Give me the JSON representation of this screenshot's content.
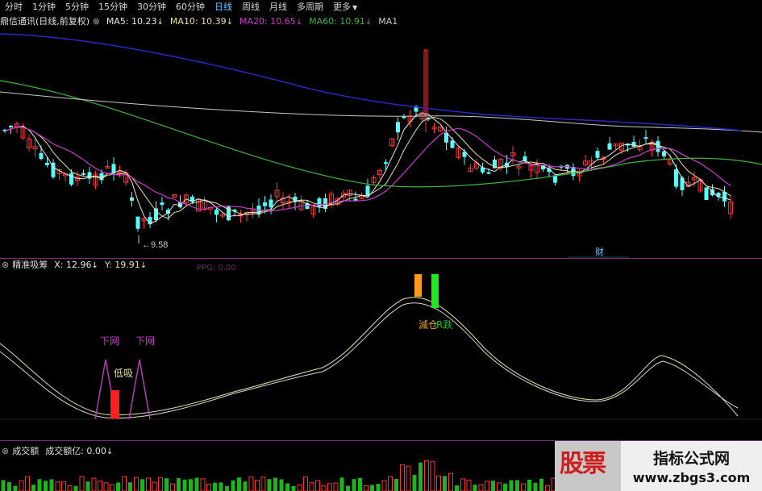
{
  "toolbar": {
    "items": [
      {
        "label": "分时",
        "active": false
      },
      {
        "label": "1分钟",
        "active": false
      },
      {
        "label": "5分钟",
        "active": false
      },
      {
        "label": "15分钟",
        "active": false
      },
      {
        "label": "30分钟",
        "active": false
      },
      {
        "label": "60分钟",
        "active": false
      },
      {
        "label": "日线",
        "active": true
      },
      {
        "label": "周线",
        "active": false
      },
      {
        "label": "月线",
        "active": false
      },
      {
        "label": "多周期",
        "active": false
      },
      {
        "label": "更多",
        "active": false
      }
    ],
    "more_caret": "▼"
  },
  "info": {
    "title": "鼎信通讯(日线,前复权)",
    "ma5": "MA5: 10.23",
    "ma10": "MA10: 10.39",
    "ma20": "MA20: 10.65",
    "ma60": "MA60: 10.91",
    "ma_extra": "MA1",
    "down_arrow": "↓"
  },
  "colors": {
    "up": "#ff3232",
    "down": "#54ffff",
    "ma5": "#e8e8e8",
    "ma10": "#e8e0a0",
    "ma20": "#c83cc8",
    "ma60": "#3cb43c",
    "ma_long": "#2828c8",
    "ma_extra": "#c8c8c8",
    "vol_up": "#ff3232",
    "vol_down": "#1eb41e"
  },
  "main_chart": {
    "low_label": "9.58",
    "cai_label": "财"
  },
  "indicator": {
    "name": "精准吸筹",
    "x_value": "X: 12.96",
    "y_value": "Y: 19.91",
    "extra": "PPG: 0.00",
    "labels": {
      "xiawang1": "下网",
      "xiawang2": "下网",
      "dixi": "低吸",
      "top": "減仓",
      "top2": "R跌"
    }
  },
  "volume": {
    "name": "成交额",
    "value": "成交额亿: 0.00"
  },
  "watermark": {
    "logo": "股票",
    "title": "指标公式网",
    "url": "www.zbgs3.com"
  }
}
